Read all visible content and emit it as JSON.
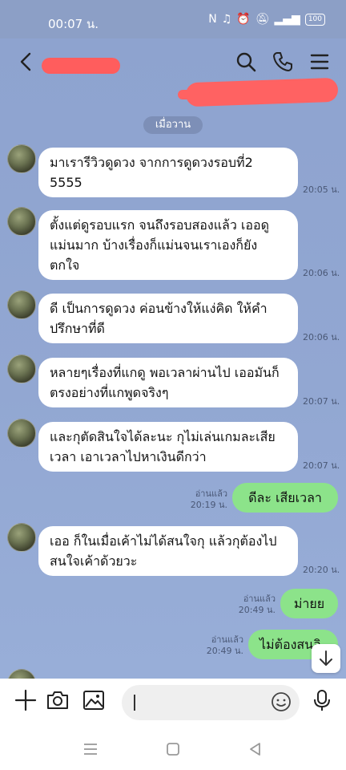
{
  "status_bar": {
    "time": "00:07 น.",
    "battery": "100"
  },
  "header": {
    "contact_name": ""
  },
  "date_divider": "เมื่อวาน",
  "messages": [
    {
      "side": "received",
      "text": "มาเรารีวิวดูดวง จากการดูดวงรอบที่2 5555",
      "time": "20:05 น."
    },
    {
      "side": "received",
      "text": "ตั้งแต่ดูรอบแรก จนถึงรอบสองแล้ว เออดูแม่นมาก บ้างเรื่องก็แม่นจนเราเองก็ยังตกใจ",
      "time": "20:06 น."
    },
    {
      "side": "received",
      "text": "ดี เป็นการดูดวง ค่อนข้างให้แง่คิด ให้คำปรึกษาที่ดี",
      "time": "20:06 น."
    },
    {
      "side": "received",
      "text": "หลายๆเรื่องที่แกดู พอเวลาผ่านไป เออมันก็ตรงอย่างที่แกพูดจริงๆ",
      "time": "20:07 น."
    },
    {
      "side": "received",
      "text": "และกุตัดสินใจได้ละนะ กุไม่เล่นเกมละเสียเวลา เอาเวลาไปหาเงินดีกว่า",
      "time": "20:07 น."
    },
    {
      "side": "sent",
      "text": "ดีละ เสียเวลา",
      "read": "อ่านแล้ว",
      "time": "20:19 น."
    },
    {
      "side": "received",
      "text": "เออ ก็ในเมื่อเค้าไม่ได้สนใจกุ แล้วกุต้องไปสนใจเค้าด้วยวะ",
      "time": "20:20 น."
    },
    {
      "side": "sent",
      "text": "ม่ายย",
      "read": "อ่านแล้ว",
      "time": "20:49 น."
    },
    {
      "side": "sent",
      "text": "ไม่ต้องสนอิ",
      "read": "อ่านแล้ว",
      "time": "20:49 น."
    }
  ],
  "input": {
    "placeholder": ""
  },
  "icons": {
    "back": "chevron-left-icon",
    "search": "search-icon",
    "call": "phone-icon",
    "menu": "menu-icon",
    "add": "plus-icon",
    "camera": "camera-icon",
    "gallery": "image-icon",
    "emoji": "smiley-icon",
    "voice": "microphone-icon",
    "scroll_down": "arrow-down-icon"
  },
  "colors": {
    "chat_background": "#92a7d2",
    "sent_bubble": "#8ce38a",
    "received_bubble": "#ffffff",
    "redaction": "#ff5d5d"
  }
}
